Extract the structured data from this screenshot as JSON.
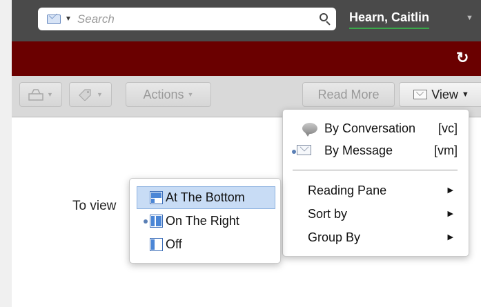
{
  "header": {
    "search": {
      "placeholder": "Search"
    },
    "user_name": "Hearn, Caitlin"
  },
  "toolbar": {
    "actions_label": "Actions",
    "read_more_label": "Read More",
    "view_label": "View"
  },
  "content": {
    "message": "To view"
  },
  "view_menu": {
    "items": [
      {
        "label": "By Conversation",
        "shortcut": "[vc]",
        "icon": "conversation-bubble-icon",
        "selected": false
      },
      {
        "label": "By Message",
        "shortcut": "[vm]",
        "icon": "envelope-icon",
        "selected": true
      }
    ],
    "submenus": [
      {
        "label": "Reading Pane"
      },
      {
        "label": "Sort by"
      },
      {
        "label": "Group By"
      }
    ]
  },
  "reading_pane_menu": {
    "items": [
      {
        "label": "At The Bottom",
        "icon": "pane-bottom-icon",
        "highlighted": true,
        "selected": false
      },
      {
        "label": "On The Right",
        "icon": "pane-right-icon",
        "highlighted": false,
        "selected": true
      },
      {
        "label": "Off",
        "icon": "pane-off-icon",
        "highlighted": false,
        "selected": false
      }
    ]
  },
  "colors": {
    "top_bar": "#4a4a4a",
    "brand_bar": "#6a0000",
    "toolbar": "#d9d9d9",
    "highlight": "#c8dcf5",
    "presence_underline": "#3aa84a"
  }
}
